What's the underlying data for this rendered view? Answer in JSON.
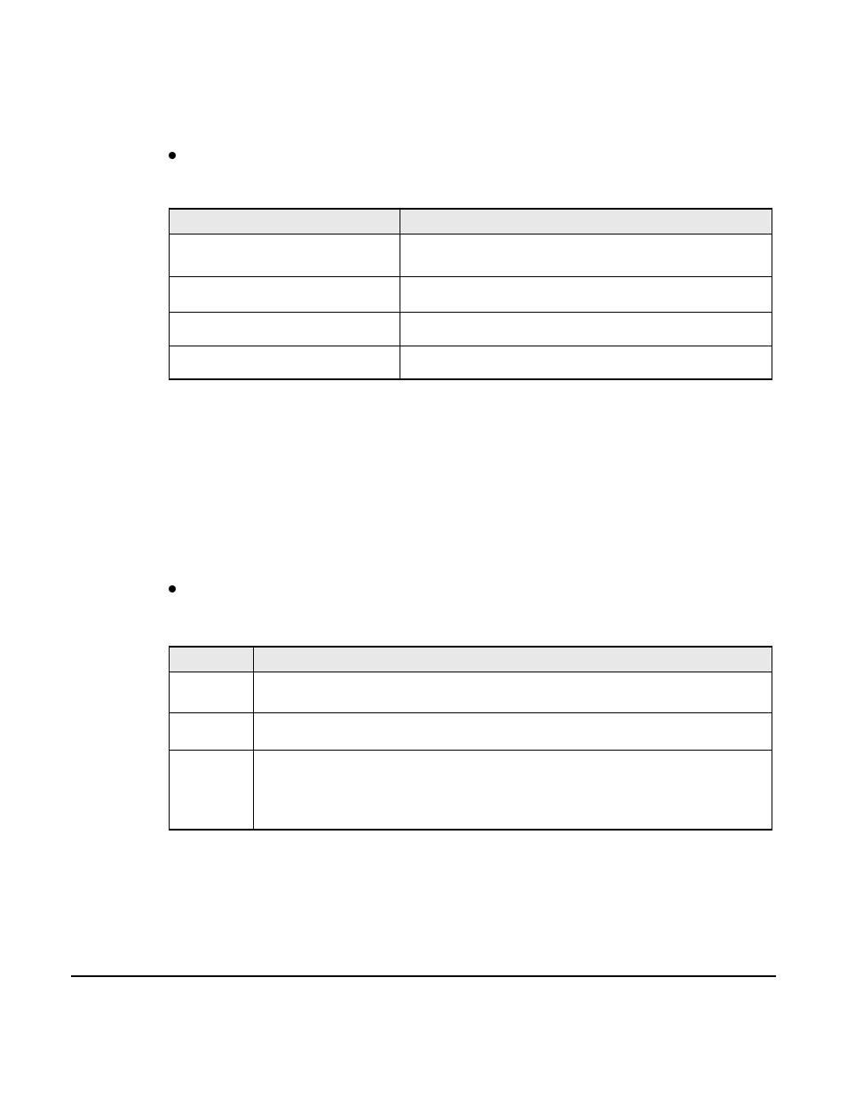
{
  "section1": {
    "bullet_text": "",
    "table": {
      "headers": [
        "",
        ""
      ],
      "rows": [
        [
          "",
          ""
        ],
        [
          "",
          ""
        ],
        [
          "",
          ""
        ],
        [
          "",
          ""
        ]
      ]
    }
  },
  "section2": {
    "bullet_text": "",
    "table": {
      "headers": [
        "",
        ""
      ],
      "rows": [
        [
          "",
          ""
        ],
        [
          "",
          ""
        ],
        [
          "",
          ""
        ]
      ]
    }
  }
}
